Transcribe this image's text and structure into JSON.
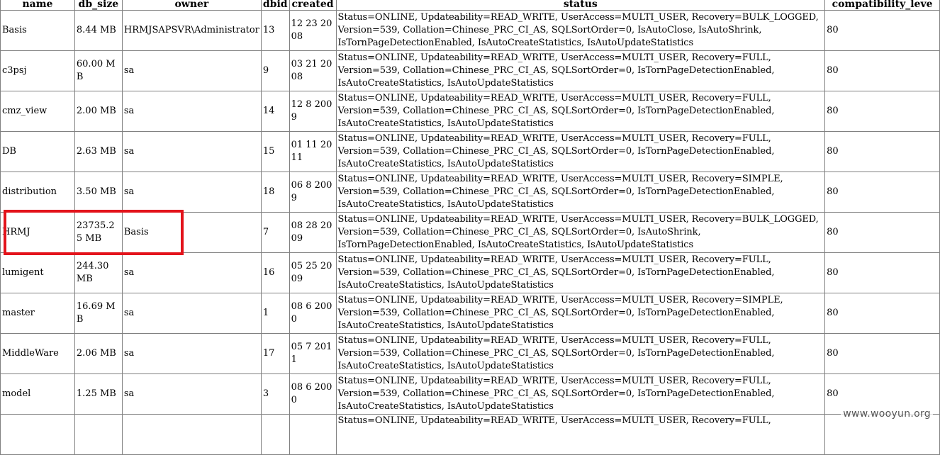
{
  "columns": [
    "name",
    "db_size",
    "owner",
    "dbid",
    "created",
    "status",
    "compatibility_leve"
  ],
  "rows": [
    {
      "name": "Basis",
      "db_size": "8.44 MB",
      "owner": "HRMJSAPSVR\\Administrator",
      "dbid": "13",
      "created": "12 23 2008",
      "status": "Status=ONLINE, Updateability=READ_WRITE, UserAccess=MULTI_USER, Recovery=BULK_LOGGED,\nVersion=539, Collation=Chinese_PRC_CI_AS, SQLSortOrder=0, IsAutoClose, IsAutoShrink,\nIsTornPageDetectionEnabled, IsAutoCreateStatistics, IsAutoUpdateStatistics",
      "compatibility_level": "80"
    },
    {
      "name": "c3psj",
      "db_size": "60.00 MB",
      "owner": "sa",
      "dbid": "9",
      "created": "03 21 2008",
      "status": "Status=ONLINE, Updateability=READ_WRITE, UserAccess=MULTI_USER, Recovery=FULL,\nVersion=539, Collation=Chinese_PRC_CI_AS, SQLSortOrder=0, IsTornPageDetectionEnabled,\nIsAutoCreateStatistics, IsAutoUpdateStatistics",
      "compatibility_level": "80"
    },
    {
      "name": "cmz_view",
      "db_size": "2.00 MB",
      "owner": "sa",
      "dbid": "14",
      "created": "12 8 2009",
      "status": "Status=ONLINE, Updateability=READ_WRITE, UserAccess=MULTI_USER, Recovery=FULL,\nVersion=539, Collation=Chinese_PRC_CI_AS, SQLSortOrder=0, IsTornPageDetectionEnabled,\nIsAutoCreateStatistics, IsAutoUpdateStatistics",
      "compatibility_level": "80"
    },
    {
      "name": "DB",
      "db_size": "2.63 MB",
      "owner": "sa",
      "dbid": "15",
      "created": "01 11 2011",
      "status": "Status=ONLINE, Updateability=READ_WRITE, UserAccess=MULTI_USER, Recovery=FULL,\nVersion=539, Collation=Chinese_PRC_CI_AS, SQLSortOrder=0, IsTornPageDetectionEnabled,\nIsAutoCreateStatistics, IsAutoUpdateStatistics",
      "compatibility_level": "80"
    },
    {
      "name": "distribution",
      "db_size": "3.50 MB",
      "owner": "sa",
      "dbid": "18",
      "created": "06 8 2009",
      "status": "Status=ONLINE, Updateability=READ_WRITE, UserAccess=MULTI_USER, Recovery=SIMPLE,\nVersion=539, Collation=Chinese_PRC_CI_AS, SQLSortOrder=0, IsTornPageDetectionEnabled,\nIsAutoCreateStatistics, IsAutoUpdateStatistics",
      "compatibility_level": "80"
    },
    {
      "name": "HRMJ",
      "db_size": "23735.25 MB",
      "owner": "Basis",
      "dbid": "7",
      "created": "08 28 2009",
      "status": "Status=ONLINE, Updateability=READ_WRITE, UserAccess=MULTI_USER, Recovery=BULK_LOGGED,\nVersion=539, Collation=Chinese_PRC_CI_AS, SQLSortOrder=0, IsAutoShrink,\nIsTornPageDetectionEnabled, IsAutoCreateStatistics, IsAutoUpdateStatistics",
      "compatibility_level": "80"
    },
    {
      "name": "lumigent",
      "db_size": "244.30 MB",
      "owner": "sa",
      "dbid": "16",
      "created": "05 25 2009",
      "status": "Status=ONLINE, Updateability=READ_WRITE, UserAccess=MULTI_USER, Recovery=FULL,\nVersion=539, Collation=Chinese_PRC_CI_AS, SQLSortOrder=0, IsTornPageDetectionEnabled,\nIsAutoCreateStatistics, IsAutoUpdateStatistics",
      "compatibility_level": "80"
    },
    {
      "name": "master",
      "db_size": "16.69 MB",
      "owner": "sa",
      "dbid": "1",
      "created": "08 6 2000",
      "status": "Status=ONLINE, Updateability=READ_WRITE, UserAccess=MULTI_USER, Recovery=SIMPLE,\nVersion=539, Collation=Chinese_PRC_CI_AS, SQLSortOrder=0, IsTornPageDetectionEnabled,\nIsAutoCreateStatistics, IsAutoUpdateStatistics",
      "compatibility_level": "80"
    },
    {
      "name": "MiddleWare",
      "db_size": "2.06 MB",
      "owner": "sa",
      "dbid": "17",
      "created": "05 7 2011",
      "status": "Status=ONLINE, Updateability=READ_WRITE, UserAccess=MULTI_USER, Recovery=FULL,\nVersion=539, Collation=Chinese_PRC_CI_AS, SQLSortOrder=0, IsTornPageDetectionEnabled,\nIsAutoCreateStatistics, IsAutoUpdateStatistics",
      "compatibility_level": "80"
    },
    {
      "name": "model",
      "db_size": "1.25 MB",
      "owner": "sa",
      "dbid": "3",
      "created": "08 6 2000",
      "status": "Status=ONLINE, Updateability=READ_WRITE, UserAccess=MULTI_USER, Recovery=FULL,\nVersion=539, Collation=Chinese_PRC_CI_AS, SQLSortOrder=0, IsTornPageDetectionEnabled,\nIsAutoCreateStatistics, IsAutoUpdateStatistics",
      "compatibility_level": "80"
    },
    {
      "name": "",
      "db_size": "",
      "owner": "",
      "dbid": "",
      "created": "",
      "status": "Status=ONLINE, Updateability=READ_WRITE, UserAccess=MULTI_USER, Recovery=FULL,",
      "compatibility_level": ""
    }
  ],
  "highlight_color": "#e3131b",
  "watermark": "www.wooyun.org"
}
